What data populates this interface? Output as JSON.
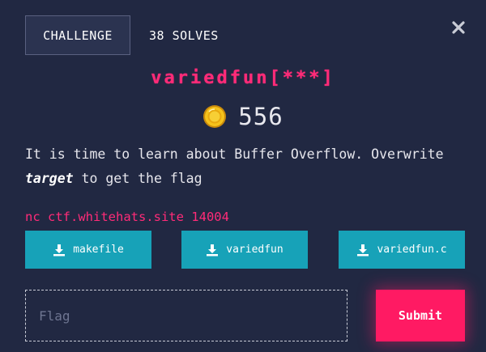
{
  "header": {
    "tab_challenge": "CHALLENGE",
    "tab_solves": "38 SOLVES"
  },
  "challenge": {
    "title": "variedfun[***]",
    "points": "556",
    "description_before": "It is time to learn about Buffer Overflow. Overwrite ",
    "description_emphasis": "target",
    "description_after": " to get the flag",
    "connection": "nc ctf.whitehats.site 14004"
  },
  "files": [
    {
      "label": "makefile",
      "icon": "download-icon"
    },
    {
      "label": "variedfun",
      "icon": "download-icon"
    },
    {
      "label": "variedfun.c",
      "icon": "download-icon"
    }
  ],
  "form": {
    "flag_placeholder": "Flag",
    "flag_value": "",
    "submit_label": "Submit"
  },
  "colors": {
    "background": "#212842",
    "accent_pink": "#ff2b78",
    "button_teal": "#17a2b8",
    "submit_pink": "#ff1a63"
  }
}
